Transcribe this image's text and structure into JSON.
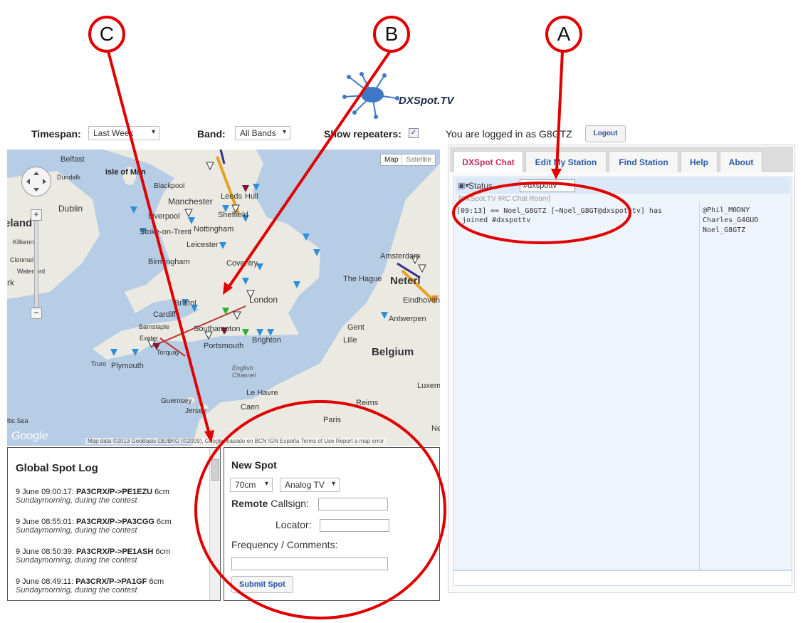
{
  "logo": {
    "text": "DXSpot.TV"
  },
  "controls": {
    "timespan_label": "Timespan:",
    "timespan_value": "Last Week",
    "band_label": "Band:",
    "band_value": "All Bands",
    "repeaters_label": "Show repeaters:",
    "repeaters_checked": true
  },
  "map": {
    "type_buttons": [
      "Map",
      "Satellite"
    ],
    "labels": {
      "belfast": "Belfast",
      "isle_of_man": "Isle of Man",
      "dundalk": "Dundalk",
      "dublin": "Dublin",
      "ireland": "eland",
      "kilkenny": "Kilkenny",
      "clonmel": "Clonmel",
      "waterford": "Waterford",
      "cork": "rk",
      "blackpool": "Blackpool",
      "manchester": "Manchester",
      "liverpool": "Liverpool",
      "leeds": "Leeds",
      "hull": "Hull",
      "sheffield": "Sheffield",
      "nottingham": "Nottingham",
      "stoke": "Stoke-on-Trent",
      "leicester": "Leicester",
      "birmingham": "Birmingham",
      "coventry": "Coventry",
      "london": "London",
      "bristol": "Bristol",
      "cardiff": "Cardiff",
      "barnstaple": "Barnstaple",
      "exeter": "Exeter",
      "torquay": "Torquay",
      "truro": "Truro",
      "plymouth": "Plymouth",
      "southampton": "Southampton",
      "portsmouth": "Portsmouth",
      "brighton": "Brighton",
      "english_channel": "English Channel",
      "guernsey": "Guernsey",
      "jersey": "Jersey",
      "le_havre": "Le Havre",
      "caen": "Caen",
      "paris": "Paris",
      "reims": "Reims",
      "celtic_sea": "ltic Sea",
      "amsterdam": "Amsterdam",
      "the_hague": "The Hague",
      "netherlands": "Neterl",
      "eindhoven": "Eindhoven",
      "antwerpen": "Antwerpen",
      "gent": "Gent",
      "lille": "Lille",
      "belgium": "Belgium",
      "luxem": "Luxem",
      "ne": "Ne"
    },
    "google": "Google",
    "attribution": "Map data ©2013 GeoBasis-DE/BKG (©2009), Google, basado en BCN IGN España   Terms of Use   Report a map error"
  },
  "spot_log": {
    "title": "Global Spot Log",
    "entries": [
      {
        "time": "9 June 09:00:17:",
        "path": "PA3CRX/P->PE1EZU",
        "band": "6cm",
        "comment": "Sundaymorning, during the contest"
      },
      {
        "time": "9 June 08:55:01:",
        "path": "PA3CRX/P->PA3CGG",
        "band": "6cm",
        "comment": "Sundaymorning, during the contest"
      },
      {
        "time": "9 June 08:50:39:",
        "path": "PA3CRX/P->PE1ASH",
        "band": "6cm",
        "comment": "Sundaymorning, during the contest"
      },
      {
        "time": "9 June 08:49:11:",
        "path": "PA3CRX/P->PA1GF",
        "band": "6cm",
        "comment": "Sundaymorning, during the contest"
      }
    ]
  },
  "new_spot": {
    "title": "New Spot",
    "band_value": "70cm",
    "mode_value": "Analog TV",
    "remote_bold": "Remote",
    "callsign_label": "Callsign:",
    "locator_label": "Locator:",
    "freq_label": "Frequency / Comments:",
    "submit_label": "Submit Spot"
  },
  "right": {
    "logged_in_text": "You are logged in as G8GTZ",
    "logout_label": "Logout",
    "tabs": [
      "DXSpot Chat",
      "Edit My Station",
      "Find Station",
      "Help",
      "About"
    ],
    "status_label": "Status",
    "status_value": "#dxspottv",
    "room_label": "[DXSpot.TV IRC Chat Room]",
    "message_line1": "[09:13] == Noel_G8GTZ [~Noel_G8GT@dxspot.tv] has",
    "message_line2": "joined #dxspottv",
    "users": [
      "@Phil_M0DNY",
      "Charles_G4GUO",
      "Noel_G8GTZ"
    ]
  },
  "callouts": {
    "a": "A",
    "b": "B",
    "c": "C"
  },
  "colors": {
    "annotation_red": "#e00000",
    "tab_active": "#c0305a",
    "tab_link": "#2a5aa8",
    "sea": "#b7cde6",
    "land": "#eaeae2"
  }
}
